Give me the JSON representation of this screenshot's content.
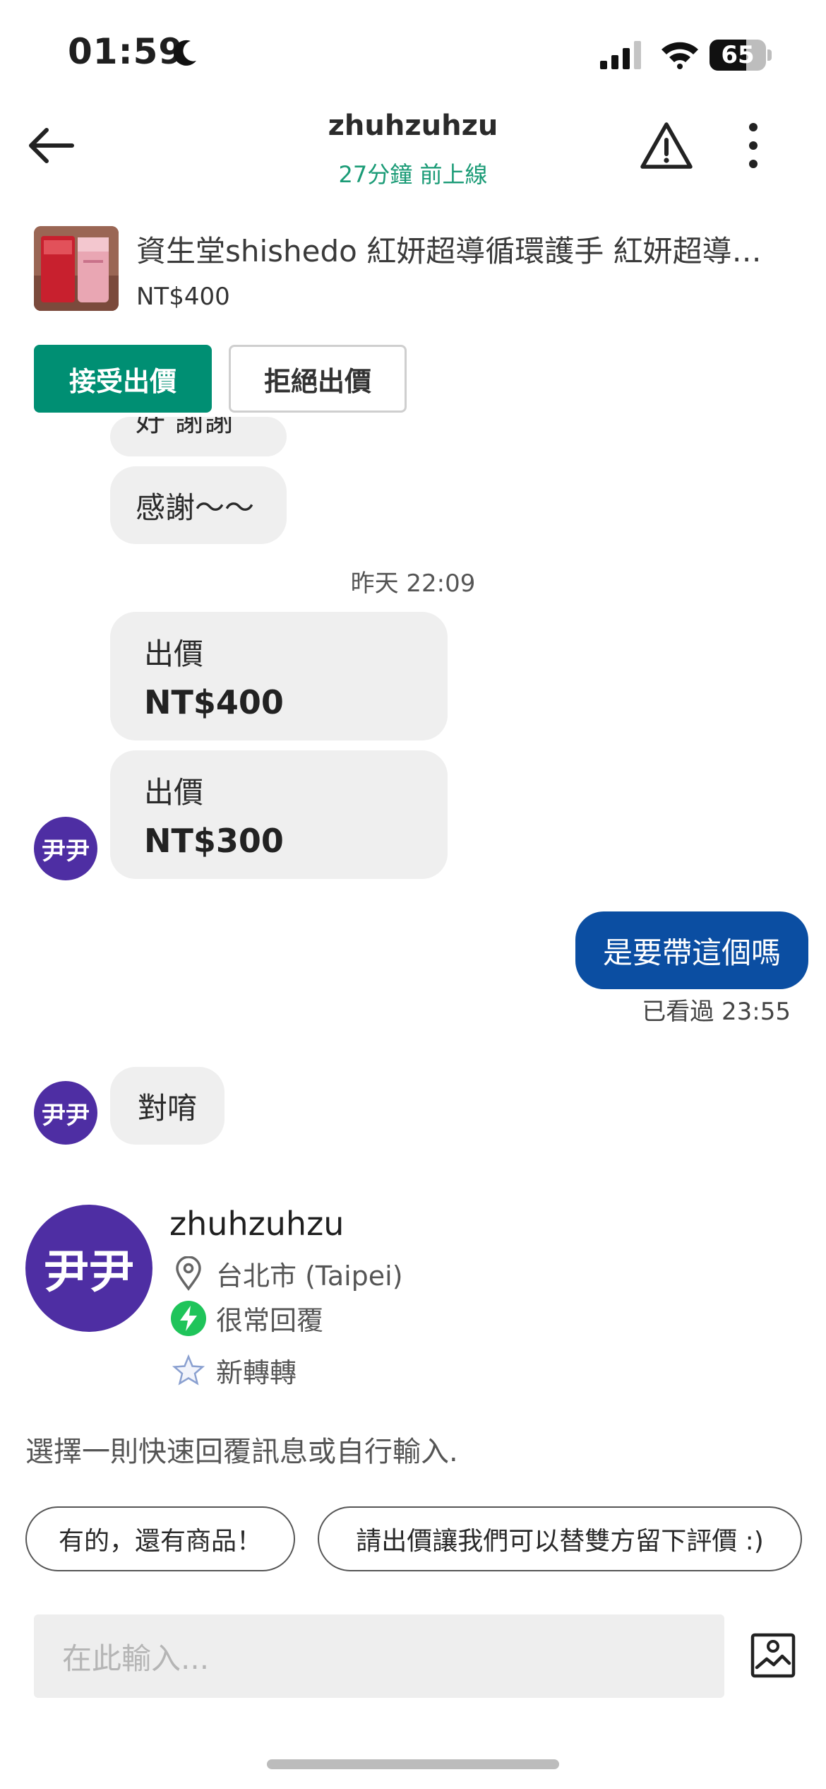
{
  "status_bar": {
    "time": "01:59",
    "battery": "65",
    "battery_level": 0.65
  },
  "header": {
    "title": "zhuhzuhzu",
    "subtitle": "27分鐘 前上線"
  },
  "product": {
    "title": "資生堂shishedo 紅妍超導循環護手 紅妍超導…",
    "price": "NT$400",
    "accept_label": "接受出價",
    "reject_label": "拒絕出價"
  },
  "chat": {
    "partial_message": "好 謝謝",
    "thanks_message": "感謝～～",
    "timestamp": "昨天 22:09",
    "offers": [
      {
        "label": "出價",
        "amount": "NT$400"
      },
      {
        "label": "出價",
        "amount": "NT$300"
      }
    ],
    "avatar_text": "尹尹",
    "outgoing_message": "是要帶這個嗎",
    "seen_label": "已看過 23:55",
    "reply_message": "對唷"
  },
  "profile": {
    "avatar_text": "尹尹",
    "name": "zhuhzuhzu",
    "location": "台北市 (Taipei)",
    "response": "很常回覆",
    "badge": "新轉轉"
  },
  "quick_reply": {
    "prompt": "選擇一則快速回覆訊息或自行輸入.",
    "chips": [
      "有的，還有商品！",
      "請出價讓我們可以替雙方留下評價 :)"
    ]
  },
  "composer": {
    "placeholder": "在此輸入..."
  },
  "colors": {
    "accent_green": "#008f73",
    "outgoing_blue": "#0b4ea2",
    "avatar_purple": "#4e2ea3",
    "online_green": "#1a9b76"
  }
}
